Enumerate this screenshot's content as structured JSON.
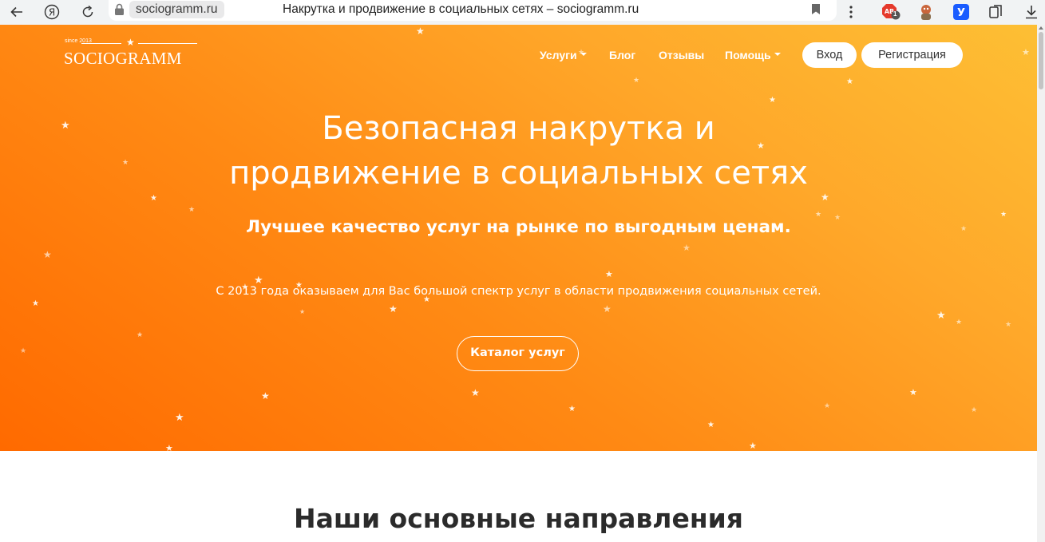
{
  "browser": {
    "domain": "sociogramm.ru",
    "tab_title": "Накрутка и продвижение в социальных сетях – sociogramm.ru",
    "ext_badge": "1"
  },
  "header": {
    "logo_since": "since 2013",
    "logo_text": "SOCIOGRAMM",
    "menu": [
      {
        "label": "Услуги",
        "dropdown": true
      },
      {
        "label": "Блог",
        "dropdown": false
      },
      {
        "label": "Отзывы",
        "dropdown": false
      },
      {
        "label": "Помощь",
        "dropdown": true
      }
    ],
    "login_label": "Вход",
    "register_label": "Регистрация"
  },
  "hero": {
    "title_line1": "Безопасная накрутка и",
    "title_line2": "продвижение в социальных сетях",
    "subtitle": "Лучшее качество услуг на рынке по выгодным ценам.",
    "lead": "С 2013 года оказываем для Вас большой спектр услуг в области продвижения социальных сетей.",
    "catalog_label": "Каталог услуг"
  },
  "section": {
    "title": "Наши основные направления"
  },
  "colors": {
    "hero_start": "#ff6a00",
    "hero_end": "#fdbf34",
    "ext_yandex": "#1a5cff",
    "ext_abp": "#e5392b"
  }
}
